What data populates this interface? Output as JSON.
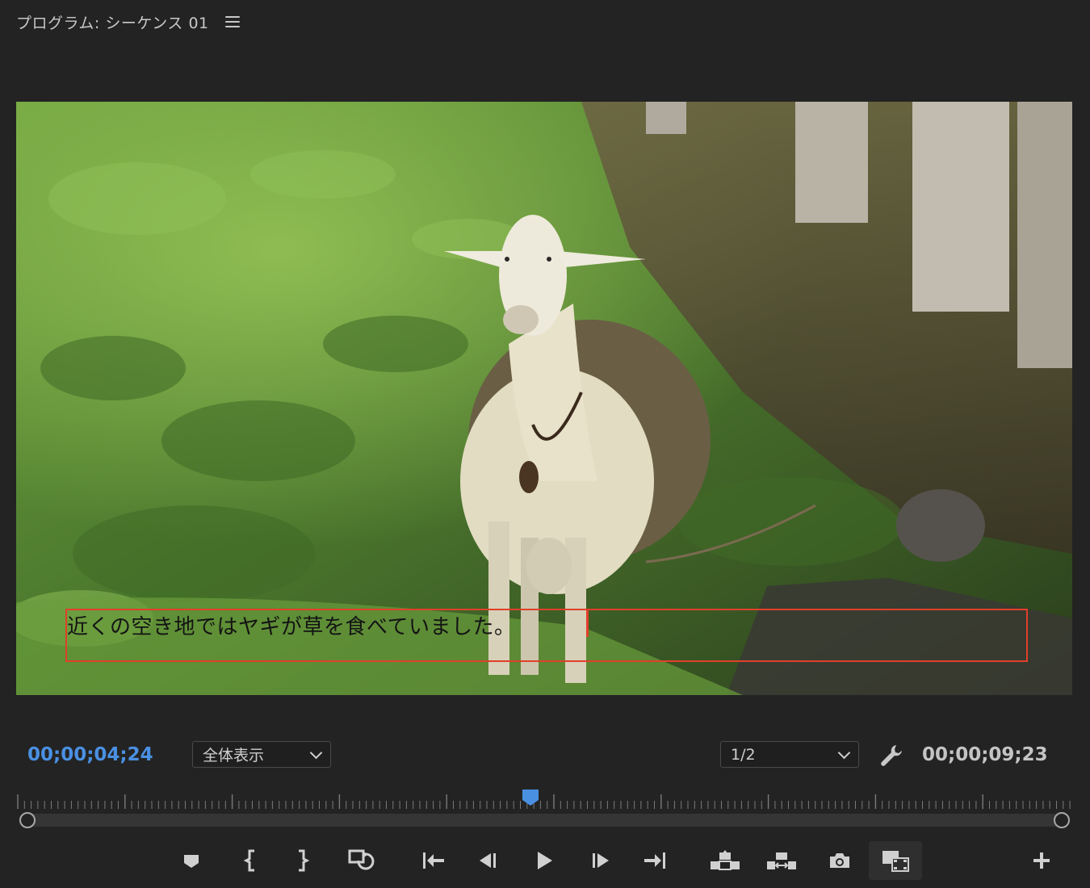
{
  "panel": {
    "title": "プログラム: シーケンス 01",
    "menu_icon": "hamburger-menu-icon"
  },
  "viewer": {
    "caption_text": "近くの空き地ではヤギが草を食べていました。",
    "caption_border_color": "#e0402a"
  },
  "timecode": {
    "current": "00;00;04;24",
    "current_color": "#4a90e2",
    "duration": "00;00;09;23"
  },
  "zoom_select": {
    "selected": "全体表示"
  },
  "resolution_select": {
    "selected": "1/2"
  },
  "settings": {
    "icon": "wrench-icon"
  },
  "playhead": {
    "position_fraction": 0.497
  },
  "transport_buttons": [
    {
      "name": "add-marker-button",
      "icon": "marker-icon"
    },
    {
      "name": "mark-in-button",
      "icon": "mark-in-icon"
    },
    {
      "name": "mark-out-button",
      "icon": "mark-out-icon"
    },
    {
      "name": "go-to-in-button",
      "icon": "go-to-in-icon"
    },
    {
      "name": "step-back-button",
      "icon": "step-back-icon"
    },
    {
      "name": "play-button",
      "icon": "play-icon"
    },
    {
      "name": "step-forward-button",
      "icon": "step-forward-icon"
    },
    {
      "name": "go-to-out-button",
      "icon": "go-to-out-icon"
    },
    {
      "name": "lift-button",
      "icon": "lift-icon"
    },
    {
      "name": "extract-button",
      "icon": "extract-icon"
    },
    {
      "name": "export-frame-button",
      "icon": "camera-icon"
    },
    {
      "name": "comparison-view-button",
      "icon": "comparison-view-icon"
    },
    {
      "name": "button-editor-button",
      "icon": "plus-icon"
    }
  ]
}
